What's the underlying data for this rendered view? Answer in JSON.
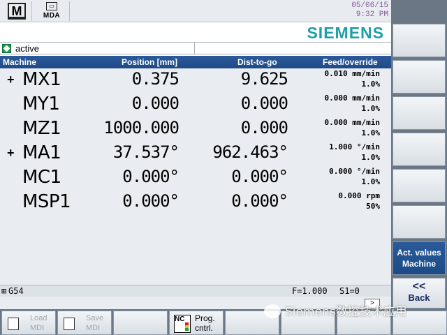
{
  "header": {
    "mode_m": "M",
    "mode_mda": "MDA",
    "date": "05/06/15",
    "time": "9:32 PM"
  },
  "brand": "SIEMENS",
  "status": {
    "text": "active",
    "color": "#18a050"
  },
  "table": {
    "headers": {
      "machine": "Machine",
      "position": "Position [mm]",
      "dtg": "Dist-to-go",
      "feed": "Feed/override"
    },
    "rows": [
      {
        "marker": "+",
        "axis": "MX1",
        "position": "0.375",
        "dtg": "9.625",
        "feed": "0.010 mm/min",
        "override": "1.0%"
      },
      {
        "marker": "",
        "axis": "MY1",
        "position": "0.000",
        "dtg": "0.000",
        "feed": "0.000 mm/min",
        "override": "1.0%"
      },
      {
        "marker": "",
        "axis": "MZ1",
        "position": "1000.000",
        "dtg": "0.000",
        "feed": "0.000 mm/min",
        "override": "1.0%"
      },
      {
        "marker": "+",
        "axis": "MA1",
        "position": "37.537°",
        "dtg": "962.463°",
        "feed": "1.000 °/min",
        "override": "1.0%"
      },
      {
        "marker": "",
        "axis": "MC1",
        "position": "0.000°",
        "dtg": "0.000°",
        "feed": "0.000 °/min",
        "override": "1.0%"
      },
      {
        "marker": "",
        "axis": "MSP1",
        "position": "0.000°",
        "dtg": "0.000°",
        "feed": "0.000 rpm",
        "override": "50%"
      }
    ]
  },
  "footer": {
    "frame": "G54",
    "feed": "F=1.000",
    "spindle": "S1=0",
    "scroll_label": ">"
  },
  "vertical_softkeys": {
    "act_values_line1": "Act. values",
    "act_values_line2": "Machine",
    "back_chevron": "<<",
    "back": "Back"
  },
  "horizontal_softkeys": {
    "load_mdi_line1": "Load",
    "load_mdi_line2": "MDI",
    "save_mdi_line1": "Save",
    "save_mdi_line2": "MDI",
    "prog_cntrl_line1": "Prog.",
    "prog_cntrl_line2": "cntrl.",
    "nc_icon": "NC"
  },
  "watermark": "Siemens数控技术应用",
  "colors": {
    "brand": "#1e9fa8",
    "header_blue": "#2c5a9a",
    "active_softkey": "#1b4a88"
  }
}
